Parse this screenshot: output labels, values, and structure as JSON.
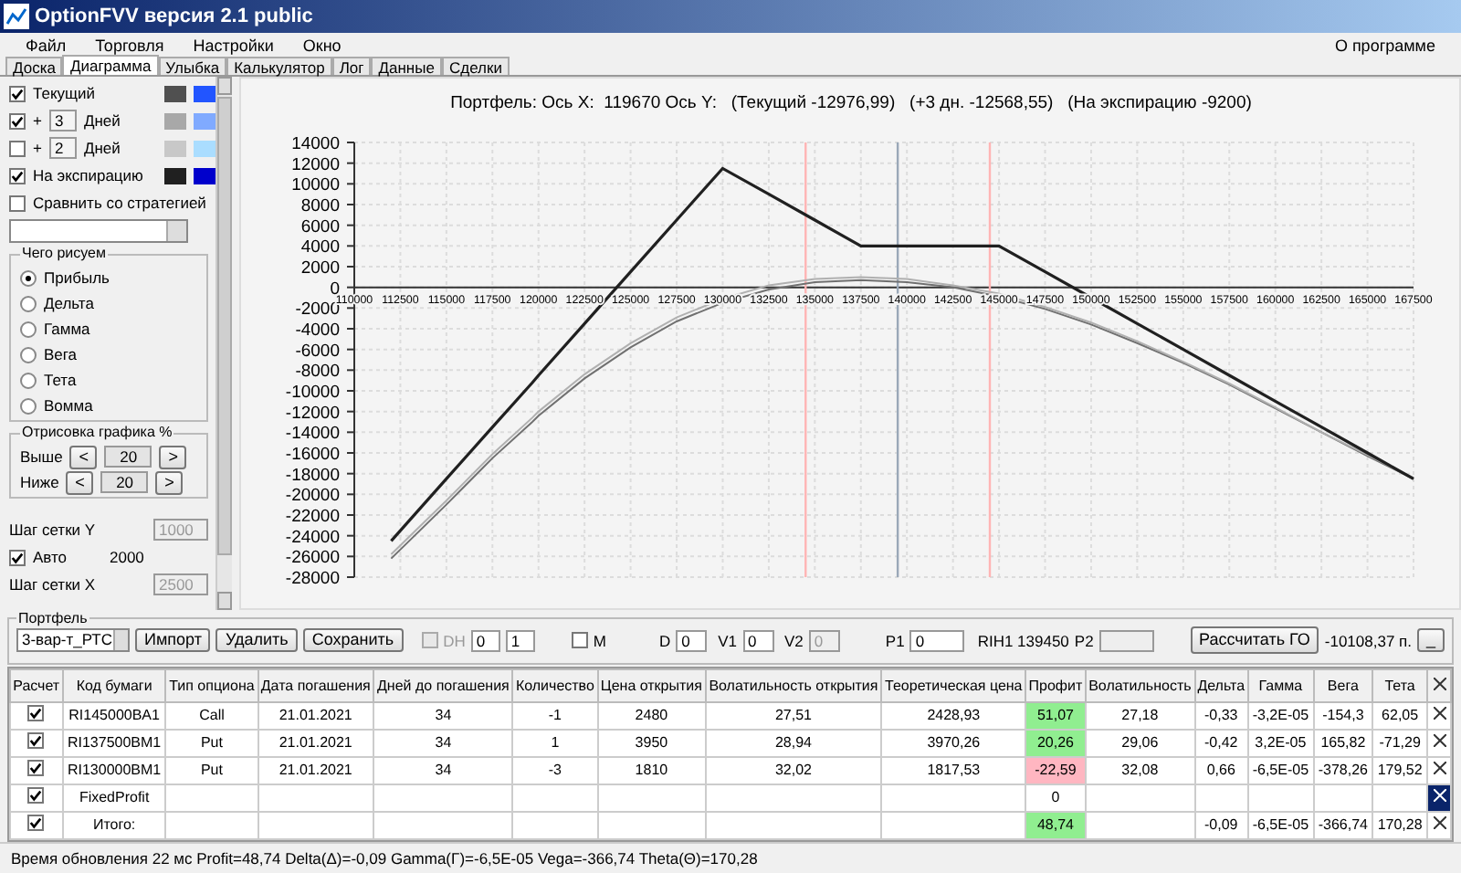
{
  "window": {
    "title": "OptionFVV версия 2.1 public"
  },
  "menu": {
    "items": [
      "Файл",
      "Торговля",
      "Настройки",
      "Окно"
    ],
    "right_item": "О программе"
  },
  "tabs": [
    {
      "label": "Доска",
      "selected": false
    },
    {
      "label": "Диаграмма",
      "selected": true
    },
    {
      "label": "Улыбка",
      "selected": false
    },
    {
      "label": "Калькулятор",
      "selected": false
    },
    {
      "label": "Лог",
      "selected": false
    },
    {
      "label": "Данные",
      "selected": false
    },
    {
      "label": "Сделки",
      "selected": false
    }
  ],
  "left_panel": {
    "series": [
      {
        "label": "Текущий",
        "checked": true,
        "swatches": [
          {
            "color": "#505050"
          },
          {
            "color": "#2255ff"
          }
        ]
      },
      {
        "prefix": "+",
        "days": "3",
        "label": "Дней",
        "checked": true,
        "swatches": [
          {
            "color": "#a8a8a8"
          },
          {
            "color": "#80aaff"
          }
        ]
      },
      {
        "prefix": "+",
        "days": "2",
        "label": "Дней",
        "checked": false,
        "swatches": [
          {
            "color": "#c8c8c8"
          },
          {
            "color": "#aaddff"
          }
        ]
      },
      {
        "label": "На экспирацию",
        "checked": true,
        "swatches": [
          {
            "color": "#202020"
          },
          {
            "color": "#0000cc"
          }
        ]
      }
    ],
    "compare": {
      "label": "Сравнить со стратегией",
      "checked": false
    },
    "draw_group": {
      "title": "Чего рисуем",
      "options": [
        {
          "label": "Прибыль",
          "selected": true
        },
        {
          "label": "Дельта",
          "selected": false
        },
        {
          "label": "Гамма",
          "selected": false
        },
        {
          "label": "Вега",
          "selected": false
        },
        {
          "label": "Тета",
          "selected": false
        },
        {
          "label": "Вомма",
          "selected": false
        }
      ]
    },
    "range_group": {
      "title": "Отрисовка графика %",
      "rows": [
        {
          "label": "Выше",
          "dec": "<",
          "value": "20",
          "inc": ">"
        },
        {
          "label": "Ниже",
          "dec": "<",
          "value": "20",
          "inc": ">"
        }
      ]
    },
    "grid_y": {
      "label": "Шаг сетки Y",
      "value": "1000",
      "disabled": true
    },
    "auto": {
      "label": "Авто",
      "checked": true,
      "value": "2000"
    },
    "grid_x": {
      "label": "Шаг сетки X",
      "value": "2500",
      "disabled": true
    }
  },
  "chart": {
    "chart_data": {
      "type": "line",
      "title": "Портфель: Ось X:  119670 Ось Y:   (Текущий -12976,99)   (+3 дн. -12568,55)   (На экспирацию -9200)",
      "x": [
        112000,
        115000,
        117500,
        119670,
        120000,
        122500,
        125000,
        127500,
        130000,
        132500,
        135000,
        137500,
        140000,
        142500,
        145000,
        147500,
        150000,
        152500,
        155000,
        157500,
        160000,
        162500,
        165000,
        167500
      ],
      "series": [
        {
          "color": "#707070",
          "values": [
            -26200,
            -21000,
            -16500,
            -13000,
            -12400,
            -8800,
            -5800,
            -3300,
            -1500,
            -200,
            500,
            700,
            500,
            0,
            -900,
            -2100,
            -3600,
            -5400,
            -7300,
            -9400,
            -11700,
            -14000,
            -16300,
            -18500
          ]
        },
        {
          "color": "#b0b0b0",
          "values": [
            -25800,
            -20600,
            -16100,
            -12600,
            -12000,
            -8400,
            -5400,
            -2900,
            -1100,
            200,
            800,
            1000,
            800,
            200,
            -600,
            -1900,
            -3400,
            -5200,
            -7200,
            -9300,
            -11600,
            -14000,
            -16200,
            -18400
          ]
        },
        {
          "color": "#202020",
          "values": [
            -24500,
            -18500,
            -13500,
            -9200,
            -8500,
            -3500,
            1500,
            6500,
            11500,
            9000,
            6500,
            4000,
            4000,
            4000,
            4000,
            1500,
            -1000,
            -3500,
            -6000,
            -8500,
            -11000,
            -13500,
            -16000,
            -18500
          ]
        }
      ],
      "xlim": [
        110000,
        167500
      ],
      "ylim": [
        -28000,
        14000
      ],
      "xticks": [
        110000,
        112500,
        115000,
        117500,
        120000,
        122500,
        125000,
        127500,
        130000,
        132500,
        135000,
        137500,
        140000,
        142500,
        145000,
        147500,
        150000,
        152500,
        155000,
        157500,
        160000,
        162500,
        165000,
        167500
      ],
      "yticks": [
        -28000,
        -26000,
        -24000,
        -22000,
        -20000,
        -18000,
        -16000,
        -14000,
        -12000,
        -10000,
        -8000,
        -6000,
        -4000,
        -2000,
        0,
        2000,
        4000,
        6000,
        8000,
        10000,
        12000,
        14000
      ],
      "grid": true,
      "ref_lines": [
        {
          "axis": "x",
          "value": 134500,
          "color": "#ffb4b4"
        },
        {
          "axis": "x",
          "value": 144500,
          "color": "#ffb4b4"
        },
        {
          "axis": "x",
          "value": 139500,
          "color": "#9aa8b8"
        }
      ]
    }
  },
  "portfolio": {
    "title": "Портфель",
    "strategy": "3-вар-т_РТС",
    "buttons": [
      "Импорт",
      "Удалить",
      "Сохранить"
    ],
    "dh": {
      "label": "DH",
      "checked": false,
      "disabled": true
    },
    "spin_1": "0",
    "spin_2": "1",
    "m": {
      "label": "M",
      "checked": false
    },
    "fields": [
      {
        "label": "D",
        "value": "0",
        "disabled": false
      },
      {
        "label": "V1",
        "value": "0",
        "disabled": false
      },
      {
        "label": "V2",
        "value": "0",
        "disabled": true
      },
      {
        "label": "P1",
        "value": "0",
        "disabled": false
      }
    ],
    "instrument": "RIH1 139450",
    "p2": {
      "label": "P2",
      "disabled": true
    },
    "calc_button": "Рассчитать ГО",
    "margin": "-10108,37 п.",
    "small_button": "_"
  },
  "table": {
    "check_column": "Расчет",
    "columns": [
      "Код бумаги",
      "Тип опциона",
      "Дата погашения",
      "Дней до погашения",
      "Количество",
      "Цена открытия",
      "Волатильность открытия",
      "Теоретическая цена",
      "Профит",
      "Волатильность",
      "Дельта",
      "Гамма",
      "Вега",
      "Тета"
    ],
    "rows": [
      {
        "checked": true,
        "cells": [
          "RI145000BA1",
          "Call",
          "21.01.2021",
          "34",
          "-1",
          "2480",
          "27,51",
          "2428,93",
          "51,07",
          "27,18",
          "-0,33",
          "-3,2E-05",
          "-154,3",
          "62,05"
        ],
        "color": "#90ee90",
        "delete_focused": false
      },
      {
        "checked": true,
        "cells": [
          "RI137500BM1",
          "Put",
          "21.01.2021",
          "34",
          "1",
          "3950",
          "28,94",
          "3970,26",
          "20,26",
          "29,06",
          "-0,42",
          "3,2E-05",
          "165,82",
          "-71,29"
        ],
        "color": "#90ee90",
        "delete_focused": false
      },
      {
        "checked": true,
        "cells": [
          "RI130000BM1",
          "Put",
          "21.01.2021",
          "34",
          "-3",
          "1810",
          "32,02",
          "1817,53",
          "-22,59",
          "32,08",
          "0,66",
          "-6,5E-05",
          "-378,26",
          "179,52"
        ],
        "color": "#ffb6c1",
        "delete_focused": false
      },
      {
        "checked": true,
        "cells": [
          "FixedProfit",
          null,
          null,
          null,
          null,
          null,
          null,
          null,
          "0",
          null,
          null,
          null,
          null,
          null
        ],
        "color": "#ffffff",
        "delete_focused": true
      },
      {
        "checked": true,
        "cells": [
          "Итого:",
          null,
          null,
          null,
          null,
          null,
          null,
          null,
          "48,74",
          null,
          "-0,09",
          "-6,5E-05",
          "-366,74",
          "170,28"
        ],
        "color": "#90ee90",
        "delete_focused": false
      }
    ]
  },
  "status_bar": "Время обновления 22 мс  Profit=48,74 Delta(Δ)=-0,09 Gamma(Γ)=-6,5E-05 Vega=-366,74 Theta(Θ)=170,28"
}
